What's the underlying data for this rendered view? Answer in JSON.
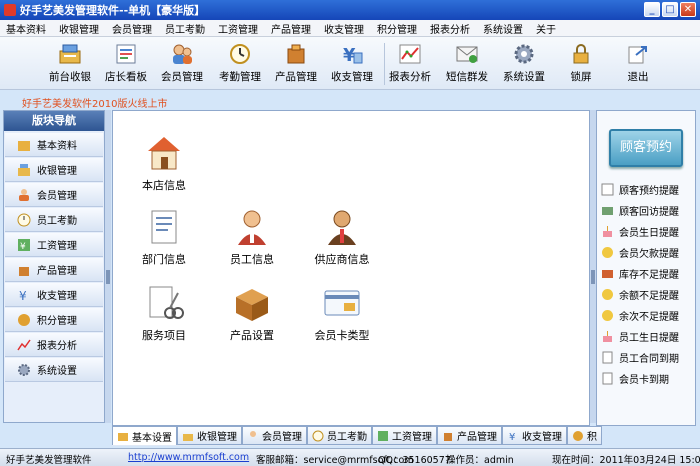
{
  "window": {
    "title": "好手艺美发管理软件--单机【豪华版】"
  },
  "menu": [
    "基本资料",
    "收银管理",
    "会员管理",
    "员工考勤",
    "工资管理",
    "产品管理",
    "收支管理",
    "积分管理",
    "报表分析",
    "系统设置",
    "关于"
  ],
  "toolbar": [
    {
      "label": "前台收银",
      "icon": "cashier-icon"
    },
    {
      "label": "店长看板",
      "icon": "dashboard-icon"
    },
    {
      "label": "会员管理",
      "icon": "members-icon"
    },
    {
      "label": "考勤管理",
      "icon": "clock-icon"
    },
    {
      "label": "产品管理",
      "icon": "product-icon"
    },
    {
      "label": "收支管理",
      "icon": "money-icon"
    },
    {
      "label": "报表分析",
      "icon": "chart-icon"
    },
    {
      "label": "短信群发",
      "icon": "sms-icon"
    },
    {
      "label": "系统设置",
      "icon": "gear-icon"
    },
    {
      "label": "锁屏",
      "icon": "lock-icon"
    },
    {
      "label": "退出",
      "icon": "exit-icon"
    }
  ],
  "marquee": "好手艺美发软件2010版火线上市",
  "sidebar": {
    "title": "版块导航",
    "items": [
      "基本资料",
      "收银管理",
      "会员管理",
      "员工考勤",
      "工资管理",
      "产品管理",
      "收支管理",
      "积分管理",
      "报表分析",
      "系统设置"
    ]
  },
  "main": {
    "items": [
      {
        "label": "本店信息",
        "icon": "store-icon"
      },
      {
        "label": "部门信息",
        "icon": "department-icon"
      },
      {
        "label": "员工信息",
        "icon": "employee-icon"
      },
      {
        "label": "供应商信息",
        "icon": "supplier-icon"
      },
      {
        "label": "服务项目",
        "icon": "service-icon"
      },
      {
        "label": "产品设置",
        "icon": "box-icon"
      },
      {
        "label": "会员卡类型",
        "icon": "card-icon"
      }
    ]
  },
  "right": {
    "reserve_button": "顾客预约",
    "items": [
      "顾客预约提醒",
      "顾客回访提醒",
      "会员生日提醒",
      "会员欠款提醒",
      "库存不足提醒",
      "余额不足提醒",
      "余次不足提醒",
      "员工生日提醒",
      "员工合同到期",
      "会员卡到期"
    ]
  },
  "tabs": [
    "基本设置",
    "收银管理",
    "会员管理",
    "员工考勤",
    "工资管理",
    "产品管理",
    "收支管理",
    "积"
  ],
  "status": {
    "app": "好手艺美发管理软件",
    "url": "http://www.mrmfsoft.com",
    "email": "客服邮箱：service@mrmfsoft.com",
    "qq": "QQ：35160577",
    "operator": "操作员：admin",
    "time": "现在时间：2011年03月24日 15:06"
  },
  "colors": {
    "accent": "#1546b8",
    "marquee": "#e0501f",
    "reserve": "#4a9fc4"
  }
}
